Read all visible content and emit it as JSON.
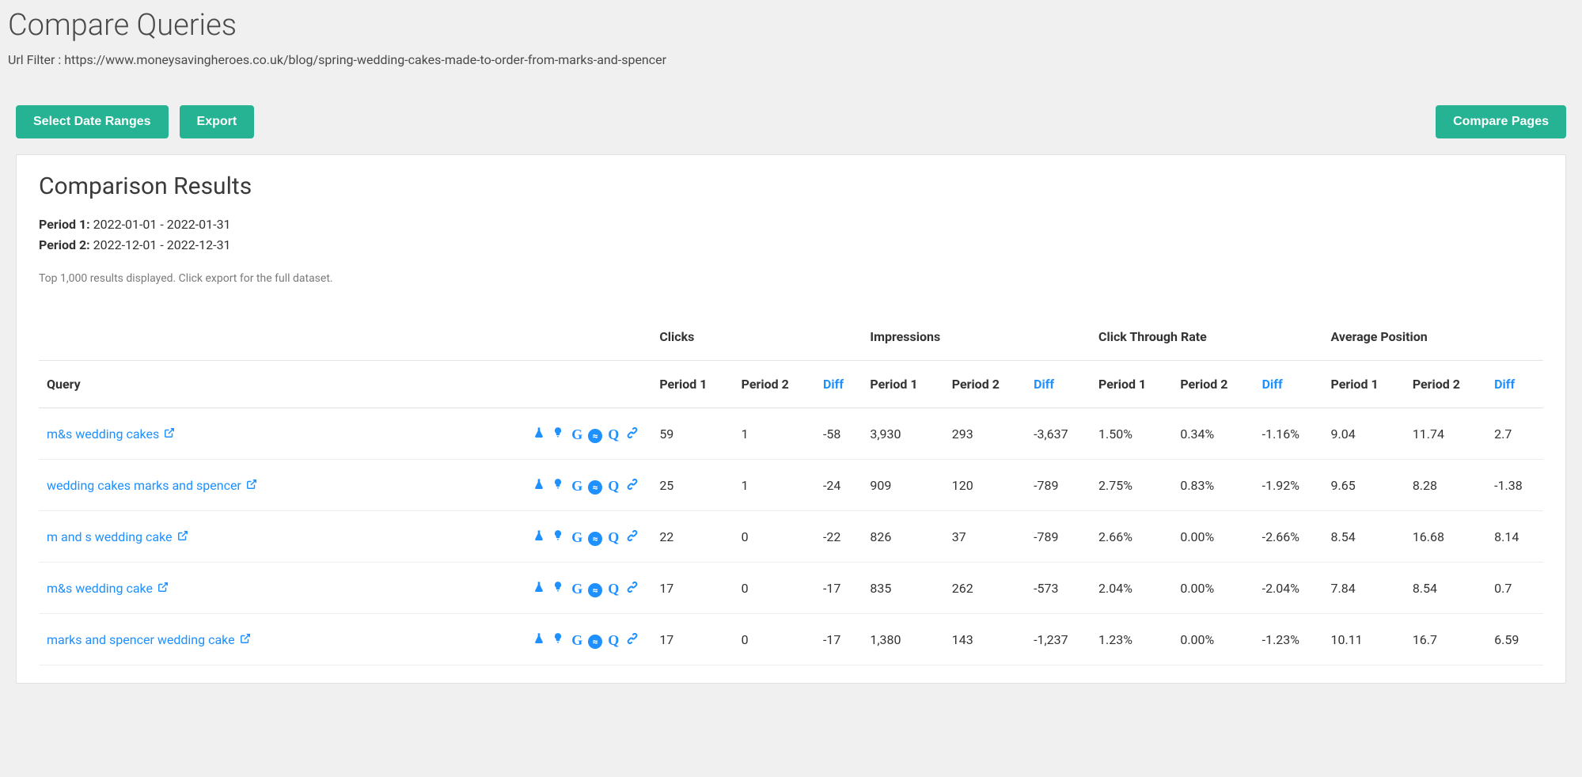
{
  "page": {
    "title": "Compare Queries",
    "url_filter_label": "Url Filter : ",
    "url_filter_value": "https://www.moneysavingheroes.co.uk/blog/spring-wedding-cakes-made-to-order-from-marks-and-spencer"
  },
  "toolbar": {
    "select_dates": "Select Date Ranges",
    "export": "Export",
    "compare_pages": "Compare Pages"
  },
  "results": {
    "heading": "Comparison Results",
    "period1_label": "Period 1:",
    "period1_value": "2022-01-01 - 2022-01-31",
    "period2_label": "Period 2:",
    "period2_value": "2022-12-01 - 2022-12-31",
    "note": "Top 1,000 results displayed. Click export for the full dataset."
  },
  "columns": {
    "query": "Query",
    "groups": {
      "clicks": "Clicks",
      "impressions": "Impressions",
      "ctr": "Click Through Rate",
      "pos": "Average Position"
    },
    "sub": {
      "p1": "Period 1",
      "p2": "Period 2",
      "diff": "Diff"
    }
  },
  "rows": [
    {
      "query": "m&s wedding cakes",
      "clicks_p1": "59",
      "clicks_p2": "1",
      "clicks_diff": "-58",
      "imp_p1": "3,930",
      "imp_p2": "293",
      "imp_diff": "-3,637",
      "ctr_p1": "1.50%",
      "ctr_p2": "0.34%",
      "ctr_diff": "-1.16%",
      "pos_p1": "9.04",
      "pos_p2": "11.74",
      "pos_diff": "2.7"
    },
    {
      "query": "wedding cakes marks and spencer",
      "clicks_p1": "25",
      "clicks_p2": "1",
      "clicks_diff": "-24",
      "imp_p1": "909",
      "imp_p2": "120",
      "imp_diff": "-789",
      "ctr_p1": "2.75%",
      "ctr_p2": "0.83%",
      "ctr_diff": "-1.92%",
      "pos_p1": "9.65",
      "pos_p2": "8.28",
      "pos_diff": "-1.38"
    },
    {
      "query": "m and s wedding cake",
      "clicks_p1": "22",
      "clicks_p2": "0",
      "clicks_diff": "-22",
      "imp_p1": "826",
      "imp_p2": "37",
      "imp_diff": "-789",
      "ctr_p1": "2.66%",
      "ctr_p2": "0.00%",
      "ctr_diff": "-2.66%",
      "pos_p1": "8.54",
      "pos_p2": "16.68",
      "pos_diff": "8.14"
    },
    {
      "query": "m&s wedding cake",
      "clicks_p1": "17",
      "clicks_p2": "0",
      "clicks_diff": "-17",
      "imp_p1": "835",
      "imp_p2": "262",
      "imp_diff": "-573",
      "ctr_p1": "2.04%",
      "ctr_p2": "0.00%",
      "ctr_diff": "-2.04%",
      "pos_p1": "7.84",
      "pos_p2": "8.54",
      "pos_diff": "0.7"
    },
    {
      "query": "marks and spencer wedding cake",
      "clicks_p1": "17",
      "clicks_p2": "0",
      "clicks_diff": "-17",
      "imp_p1": "1,380",
      "imp_p2": "143",
      "imp_diff": "-1,237",
      "ctr_p1": "1.23%",
      "ctr_p2": "0.00%",
      "ctr_diff": "-1.23%",
      "pos_p1": "10.11",
      "pos_p2": "16.7",
      "pos_diff": "6.59"
    }
  ]
}
